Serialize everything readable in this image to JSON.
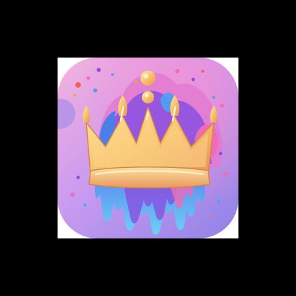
{
  "icon": {
    "name": "crown-icon",
    "subject": "crown",
    "colors": {
      "background_top": "#f2a6d8",
      "background_bottom": "#9b84e8",
      "crown_gold": "#f7c46a",
      "crown_highlight": "#fde6a8",
      "crown_shadow": "#e08a4a",
      "paint_blue": "#4aa3f0",
      "paint_purple": "#8a4fe0",
      "paint_pink": "#f06ab8"
    }
  }
}
